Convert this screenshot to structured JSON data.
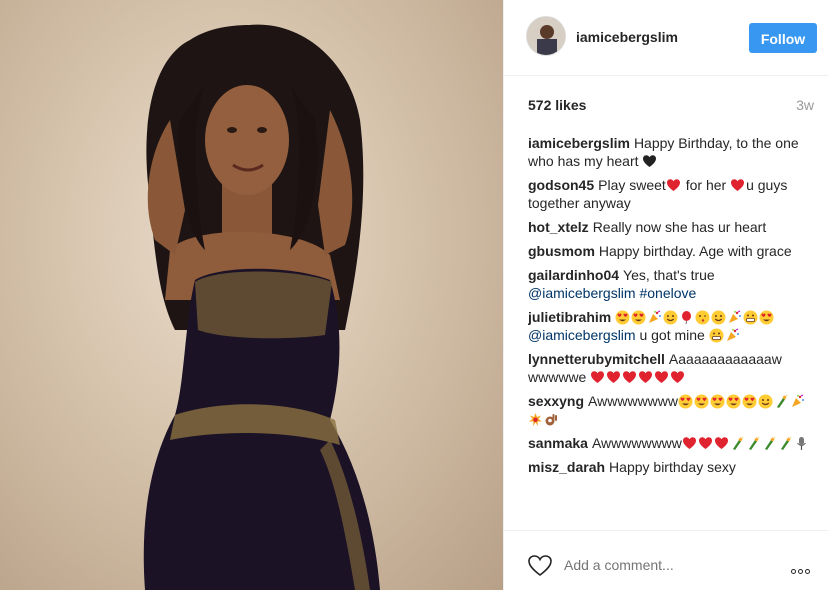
{
  "post": {
    "username": "iamicebergslim",
    "follow_label": "Follow",
    "likes": "572 likes",
    "time_ago": "3w"
  },
  "comments": [
    {
      "user": "iamicebergslim",
      "parts": [
        {
          "t": "Happy Birthday, to the one who has my heart "
        },
        {
          "e": "black-heart"
        }
      ]
    },
    {
      "user": "godson45",
      "parts": [
        {
          "t": "Play sweet"
        },
        {
          "e": "red-heart"
        },
        {
          "t": " for her "
        },
        {
          "e": "red-heart"
        },
        {
          "t": "u guys together anyway"
        }
      ]
    },
    {
      "user": "hot_xtelz",
      "parts": [
        {
          "t": "Really now she has ur heart"
        }
      ]
    },
    {
      "user": "gbusmom",
      "parts": [
        {
          "t": "Happy birthday. Age with grace"
        }
      ]
    },
    {
      "user": "gailardinho04",
      "parts": [
        {
          "t": "Yes, that's true "
        },
        {
          "m": "@iamicebergslim"
        },
        {
          "t": " "
        },
        {
          "m": "#onelove"
        }
      ]
    },
    {
      "user": "julietibrahim",
      "parts": [
        {
          "e": "heart-eyes"
        },
        {
          "e": "heart-eyes"
        },
        {
          "e": "party-popper"
        },
        {
          "e": "smile"
        },
        {
          "e": "balloon"
        },
        {
          "e": "kiss-face"
        },
        {
          "e": "smile"
        },
        {
          "e": "party-popper"
        },
        {
          "e": "grimace"
        },
        {
          "e": "heart-eyes"
        },
        {
          "t": " "
        },
        {
          "m": "@iamicebergslim"
        },
        {
          "t": " u got mine "
        },
        {
          "e": "grimace"
        },
        {
          "e": "party-popper"
        }
      ]
    },
    {
      "user": "lynnetterubymitchell",
      "parts": [
        {
          "t": "Aaaaaaaaaaaaaw wwwwwe "
        },
        {
          "e": "red-heart"
        },
        {
          "e": "red-heart"
        },
        {
          "e": "red-heart"
        },
        {
          "e": "red-heart"
        },
        {
          "e": "red-heart"
        },
        {
          "e": "red-heart"
        }
      ]
    },
    {
      "user": "sexxyng",
      "parts": [
        {
          "t": "Awwwwwwww"
        },
        {
          "e": "heart-eyes"
        },
        {
          "e": "heart-eyes"
        },
        {
          "e": "heart-eyes"
        },
        {
          "e": "heart-eyes"
        },
        {
          "e": "heart-eyes"
        },
        {
          "e": "smile"
        },
        {
          "e": "champagne"
        },
        {
          "e": "party-popper"
        },
        {
          "e": "collision"
        },
        {
          "e": "ok-hand"
        }
      ]
    },
    {
      "user": "sanmaka",
      "parts": [
        {
          "t": "Awwwwwwww"
        },
        {
          "e": "red-heart"
        },
        {
          "e": "red-heart"
        },
        {
          "e": "red-heart"
        },
        {
          "e": "champagne"
        },
        {
          "e": "champagne"
        },
        {
          "e": "champagne"
        },
        {
          "e": "champagne"
        },
        {
          "e": "microphone"
        }
      ]
    },
    {
      "user": "misz_darah",
      "parts": [
        {
          "t": "Happy birthday sexy"
        }
      ]
    }
  ],
  "footer": {
    "comment_placeholder": "Add a comment..."
  },
  "colors": {
    "follow_bg": "#3897f0",
    "mention": "#003569",
    "time": "#999999"
  },
  "icons": {
    "like": "heart-outline-icon",
    "more": "more-options-icon"
  }
}
